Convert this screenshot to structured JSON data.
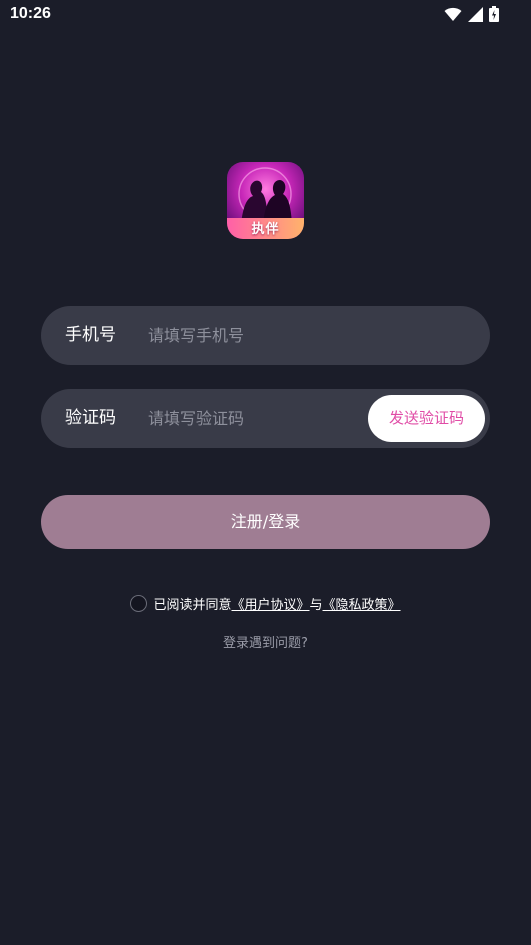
{
  "status_bar": {
    "time": "10:26",
    "icons": [
      "wifi-icon",
      "signal-icon",
      "battery-icon"
    ]
  },
  "logo": {
    "text": "执伴"
  },
  "phone_field": {
    "label": "手机号",
    "placeholder": "请填写手机号",
    "value": ""
  },
  "code_field": {
    "label": "验证码",
    "placeholder": "请填写验证码",
    "value": "",
    "send_label": "发送验证码"
  },
  "submit": {
    "label": "注册/登录"
  },
  "agreement": {
    "prefix": "已阅读并同意",
    "user_agreement": "《用户协议》",
    "connector": "与",
    "privacy_policy": "《隐私政策》",
    "checked": false
  },
  "help": {
    "label": "登录遇到问题?"
  },
  "colors": {
    "background": "#1b1d29",
    "field": "#393b48",
    "accent": "#e04ca6",
    "submit": "#9f7d93"
  }
}
